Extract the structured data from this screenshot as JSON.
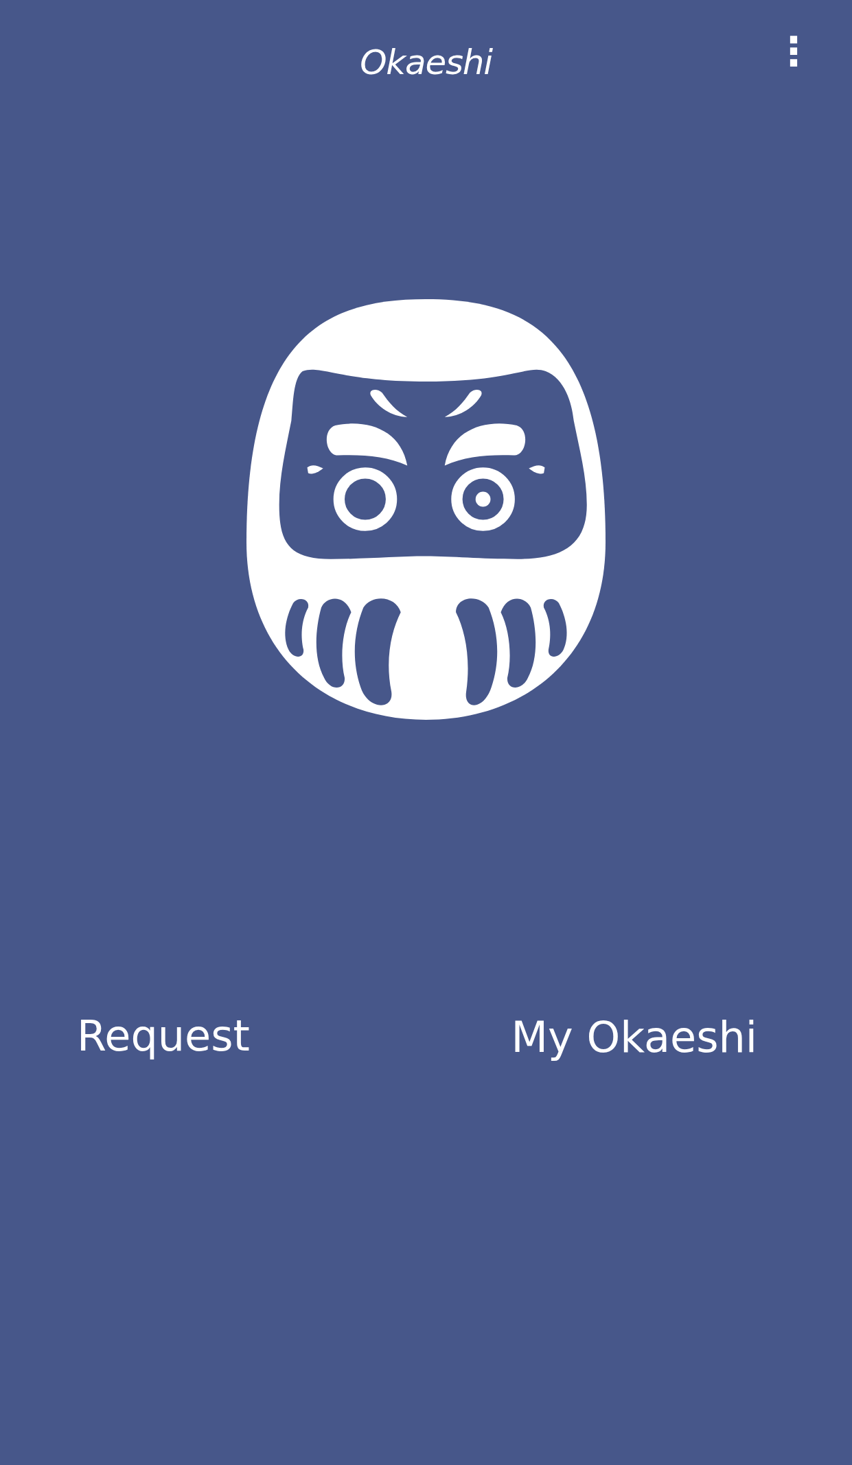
{
  "app_bar": {
    "title": "Okaeshi",
    "menu_icon": "⋮"
  },
  "buttons": [
    {
      "label": "Request"
    },
    {
      "label": "My Okaeshi"
    }
  ]
}
